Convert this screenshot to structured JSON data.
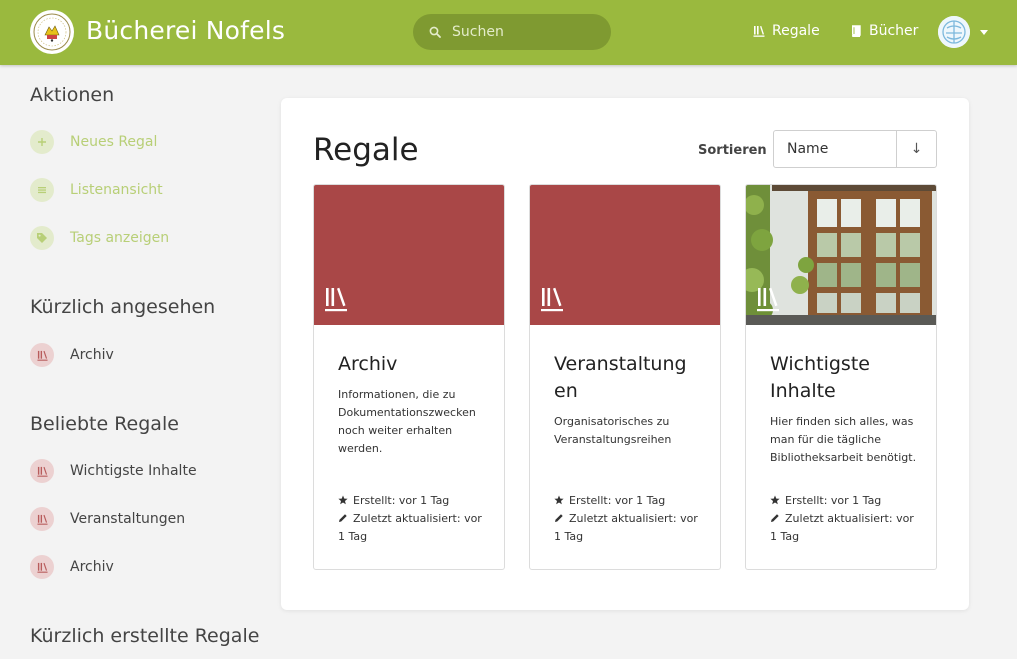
{
  "header": {
    "app_title": "Bücherei Nofels",
    "search_placeholder": "Suchen",
    "nav": [
      {
        "label": "Regale",
        "icon": "bookshelf-icon"
      },
      {
        "label": "Bücher",
        "icon": "book-icon"
      }
    ],
    "colors": {
      "brand": "#9ab93e",
      "search_bg": "#7f9a31"
    }
  },
  "sidebar": {
    "actions_title": "Aktionen",
    "actions": [
      {
        "label": "Neues Regal",
        "icon": "plus-icon"
      },
      {
        "label": "Listenansicht",
        "icon": "list-icon"
      },
      {
        "label": "Tags anzeigen",
        "icon": "tag-icon"
      }
    ],
    "recent_title": "Kürzlich angesehen",
    "recent": [
      {
        "label": "Archiv",
        "icon": "bookshelf-icon"
      }
    ],
    "popular_title": "Beliebte Regale",
    "popular": [
      {
        "label": "Wichtigste Inhalte",
        "icon": "bookshelf-icon"
      },
      {
        "label": "Veranstaltungen",
        "icon": "bookshelf-icon"
      },
      {
        "label": "Archiv",
        "icon": "bookshelf-icon"
      }
    ],
    "created_title": "Kürzlich erstellte Regale"
  },
  "main": {
    "title": "Regale",
    "sort_label": "Sortieren",
    "sort_value": "Name",
    "sort_direction": "↓",
    "cards": [
      {
        "title_line1": "Archiv",
        "title_line2": "",
        "description": "Informationen, die zu Dokumentationszwecken noch weiter erhalten werden.",
        "created": "Erstellt: vor 1 Tag",
        "updated": "Zuletzt aktualisiert: vor 1 Tag",
        "cover": "color",
        "cover_color": "#a94747"
      },
      {
        "title_line1": "Veranstaltung",
        "title_line2": "en",
        "description": "Organisatorisches zu Veranstaltungsreihen",
        "created": "Erstellt: vor 1 Tag",
        "updated": "Zuletzt aktualisiert: vor 1 Tag",
        "cover": "color",
        "cover_color": "#a94747"
      },
      {
        "title_line1": "Wichtigste",
        "title_line2": "Inhalte",
        "description": "Hier finden sich alles, was man für die tägliche Bibliotheksarbeit benötigt.",
        "created": "Erstellt: vor 1 Tag",
        "updated": "Zuletzt aktualisiert: vor 1 Tag",
        "cover": "photo-glass-doors",
        "cover_color": "#8a5a33"
      }
    ]
  }
}
